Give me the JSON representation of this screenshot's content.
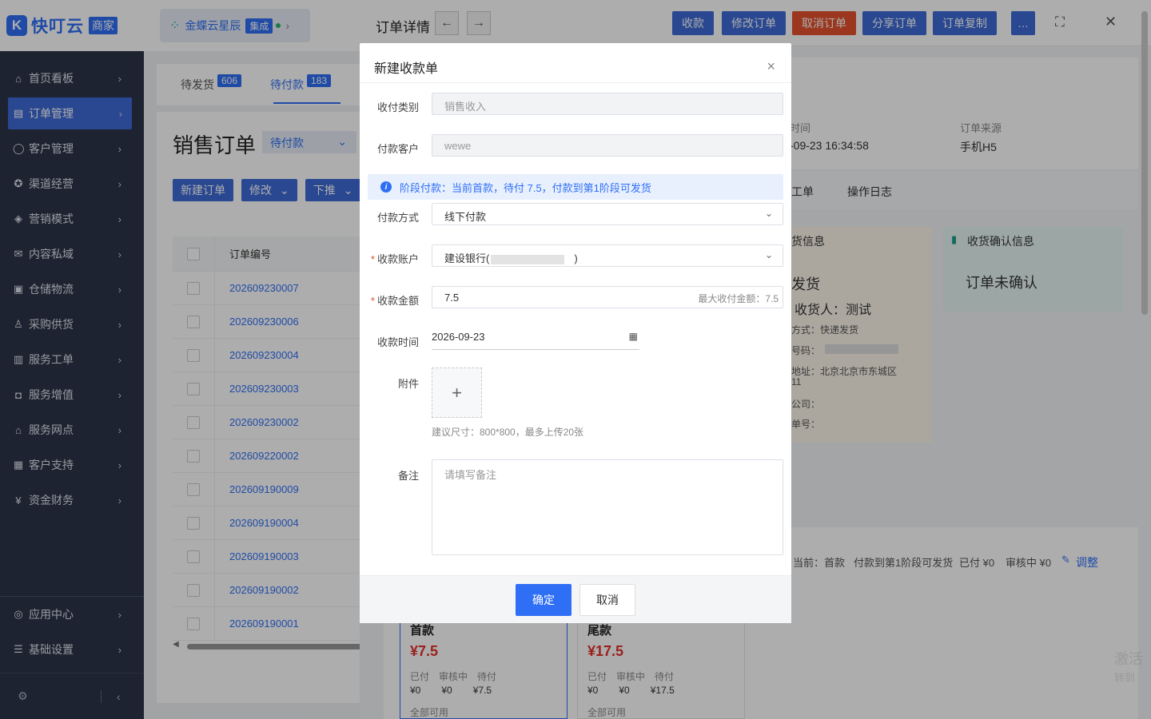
{
  "brand": {
    "logo_letter": "K",
    "name": "快叮云",
    "tag": "商家"
  },
  "integration": {
    "name": "金蝶云星辰",
    "tag": "集成"
  },
  "nav": {
    "items": [
      {
        "icon": "⌂",
        "label": "首页看板",
        "icon_name": "home-icon"
      },
      {
        "icon": "▤",
        "label": "订单管理",
        "icon_name": "order-icon",
        "active": true
      },
      {
        "icon": "◯",
        "label": "客户管理",
        "icon_name": "user-icon"
      },
      {
        "icon": "✪",
        "label": "渠道经营",
        "icon_name": "channel-icon"
      },
      {
        "icon": "◈",
        "label": "营销模式",
        "icon_name": "tag-icon"
      },
      {
        "icon": "✉",
        "label": "内容私域",
        "icon_name": "mail-icon"
      },
      {
        "icon": "▣",
        "label": "仓储物流",
        "icon_name": "warehouse-icon"
      },
      {
        "icon": "♙",
        "label": "采购供货",
        "icon_name": "supply-icon"
      },
      {
        "icon": "▥",
        "label": "服务工单",
        "icon_name": "ticket-icon"
      },
      {
        "icon": "◘",
        "label": "服务增值",
        "icon_name": "bag-icon"
      },
      {
        "icon": "⌂",
        "label": "服务网点",
        "icon_name": "store-icon"
      },
      {
        "icon": "▦",
        "label": "客户支持",
        "icon_name": "support-icon"
      },
      {
        "icon": "¥",
        "label": "资金财务",
        "icon_name": "finance-icon"
      }
    ],
    "bottom": [
      {
        "icon": "◎",
        "label": "应用中心",
        "icon_name": "app-icon"
      },
      {
        "icon": "☰",
        "label": "基础设置",
        "icon_name": "settings-icon"
      }
    ]
  },
  "tabs": [
    {
      "label": "待发货",
      "count": "606"
    },
    {
      "label": "待付款",
      "count": "183"
    }
  ],
  "orders": {
    "title": "销售订单",
    "status_filter": "待付款",
    "buttons": [
      "新建订单",
      "修改",
      "下推"
    ],
    "column": "订单编号",
    "rows": [
      "202609230007",
      "202609230006",
      "202609230004",
      "202609230003",
      "202609230002",
      "202609220002",
      "202609190009",
      "202609190004",
      "202609190003",
      "202609190002",
      "202609190001"
    ]
  },
  "detail": {
    "title": "订单详情",
    "actions": [
      "收款",
      "修改订单",
      "取消订单",
      "分享订单",
      "订单复制"
    ],
    "more": "…",
    "order_time_label": "时间",
    "order_time": "-09-23 16:34:58",
    "source_label": "订单来源",
    "source": "手机H5",
    "tab_labels": [
      "工单",
      "操作日志"
    ],
    "ship_card_title": "货信息",
    "ship_status": "发货",
    "receiver": "收货人：测试",
    "ship_method": "方式：快递发货",
    "phone_label": "号码：",
    "address": "地址：北京北京市东城区",
    "address2": "11",
    "logistics": "公司：",
    "tracking": "单号：",
    "confirm_card_title": "收货确认信息",
    "confirm_status": "订单未确认",
    "pay_summary": [
      "当前：首款",
      "付款到第1阶段可发货",
      "已付 ¥0",
      "审核中 ¥0"
    ],
    "adjust": "调整",
    "stages": [
      {
        "name": "首款",
        "amount": "¥7.5",
        "paid": "¥0",
        "review": "¥0",
        "pending": "¥7.5",
        "note": "全部可用"
      },
      {
        "name": "尾款",
        "amount": "¥17.5",
        "paid": "¥0",
        "review": "¥0",
        "pending": "¥17.5",
        "note": "全部可用"
      }
    ],
    "stage_labels": {
      "paid": "已付",
      "review": "审核中",
      "pending": "待付"
    }
  },
  "modal": {
    "title": "新建收款单",
    "close": "×",
    "category_label": "收付类别",
    "category_value": "销售收入",
    "customer_label": "付款客户",
    "customer_value": "wewe",
    "alert": "阶段付款：当前首款，待付 7.5，付款到第1阶段可发货",
    "method_label": "付款方式",
    "method_value": "线下付款",
    "account_label": "收款账户",
    "account_value_prefix": "建设银行(",
    "account_value_suffix": ")",
    "amount_label": "收款金额",
    "amount_value": "7.5",
    "amount_max": "最大收付金额：7.5",
    "time_label": "收款时间",
    "time_value": "2026-09-23",
    "attach_label": "附件",
    "attach_plus": "+",
    "attach_hint": "建议尺寸：800*800，最多上传20张",
    "note_label": "备注",
    "note_placeholder": "请填写备注",
    "ok": "确定",
    "cancel": "取消"
  },
  "watermark": [
    "激活",
    "转到"
  ]
}
